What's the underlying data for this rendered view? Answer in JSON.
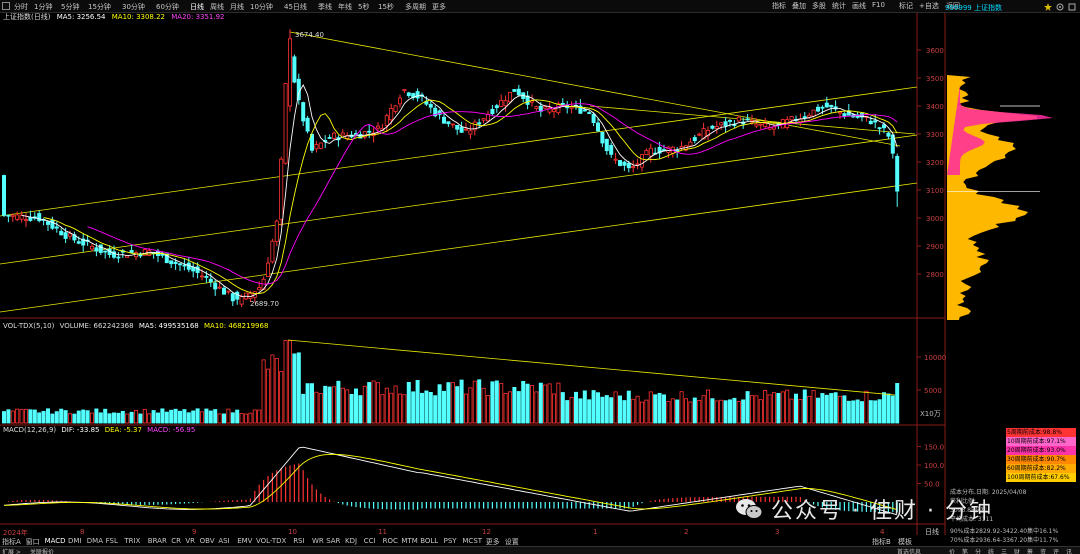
{
  "top_bar": {
    "periods": [
      "分时",
      "1分钟",
      "5分钟",
      "15分钟",
      "30分钟",
      "60分钟",
      "日线",
      "周线",
      "月线",
      "10分钟",
      "45日线",
      "季线",
      "年线",
      "5秒",
      "15秒",
      "多周期",
      "更多"
    ],
    "active_period": "日线",
    "tools": [
      "指标",
      "叠加",
      "多股",
      "统计",
      "画线",
      "F10",
      "标记",
      "+自选",
      "返回"
    ]
  },
  "panel": {
    "code_title": "999999 上证指数"
  },
  "main_info": {
    "index_name": "上证指数(日线)",
    "ma5": "MA5: 3256.54",
    "ma10": "MA10: 3308.22",
    "ma20": "MA20: 3351.92",
    "high_label": "3674.40",
    "low_label": "2689.70",
    "colors": {
      "ma5": "#ffffff",
      "ma10": "#ffff00",
      "ma20": "#ff00ff",
      "up": "#ff3232",
      "down": "#54ffff"
    }
  },
  "price_axis": [
    "3600",
    "3500",
    "3400",
    "3300",
    "3200",
    "3100",
    "3000",
    "2900",
    "2800"
  ],
  "vol_info": {
    "title": "VOL-TDX(5,10)",
    "volume": "VOLUME: 662242368",
    "ma5": "MA5: 499535168",
    "ma10": "MA10: 468219968",
    "unit": "X10万"
  },
  "vol_axis": [
    "10000",
    "5000"
  ],
  "macd_info": {
    "title": "MACD(12,26,9)",
    "dif": "DIF: -33.85",
    "dea": "DEA: -5.37",
    "macd": "MACD: -56.95"
  },
  "macd_axis": [
    "150.0",
    "100.0",
    "50.0"
  ],
  "x_axis": [
    "2024年",
    "8",
    "9",
    "10",
    "11",
    "12",
    "1",
    "2",
    "3",
    "4"
  ],
  "indicator_tabs": [
    "指标A",
    "窗口",
    "MACD",
    "DMI",
    "DMA",
    "FSL",
    "TRIX",
    "BRAR",
    "CR",
    "VR",
    "OBV",
    "ASI",
    "EMV",
    "VOL-TDX",
    "RSI",
    "WR",
    "SAR",
    "KDJ",
    "CCI",
    "ROC",
    "MTM",
    "BOLL",
    "PSY",
    "MCST",
    "更多",
    "设置"
  ],
  "active_indicator": "MACD",
  "bottom_tabs": [
    "扩展 >",
    "关联报价"
  ],
  "right_tabs": [
    "指标B",
    "模板",
    "日线"
  ],
  "right_bottom_tabs": [
    "首选信息",
    "价",
    "笔",
    "分",
    "统",
    "三",
    "财",
    "筹",
    "资",
    "评",
    "讯"
  ],
  "cost_legend": [
    {
      "label": "5周期前成本:98.8%",
      "color": "#ff3333"
    },
    {
      "label": "10周期前成本:97.1%",
      "color": "#ff66cc"
    },
    {
      "label": "20周期前成本:93.0%",
      "color": "#ff33aa"
    },
    {
      "label": "30周期前成本:90.7%",
      "color": "#ff8800"
    },
    {
      "label": "60周期前成本:82.2%",
      "color": "#ffaa00"
    },
    {
      "label": "100周期前成本:67.6%",
      "color": "#ffcc00"
    }
  ],
  "cost_info": {
    "date_line": "成本分布,日期: 2025/04/08",
    "profit_line": "获利比例:",
    "price_line": "3093.85获利",
    "avg_line": "平均成本: 3111",
    "line90": "90%成本2829.92-3422.40集中16.1%",
    "line70": "70%成本2936.64-3367.20集中11.7%"
  },
  "watermark": {
    "brand": "公众号 · 佳财 · 分钟"
  },
  "chart_data": {
    "type": "candlestick",
    "title": "上证指数(日线)",
    "high": 3674.4,
    "low": 2689.7,
    "price_axis_range": [
      2700,
      3700
    ],
    "monthly_closes": {
      "categories": [
        "2024-07",
        "2024-08",
        "2024-09",
        "2024-10",
        "2024-11",
        "2024-12",
        "2025-01",
        "2025-02",
        "2025-03",
        "2025-04"
      ],
      "values": [
        2940,
        2842,
        3336,
        3279,
        3326,
        3352,
        3250,
        3320,
        3336,
        3094
      ]
    }
  }
}
